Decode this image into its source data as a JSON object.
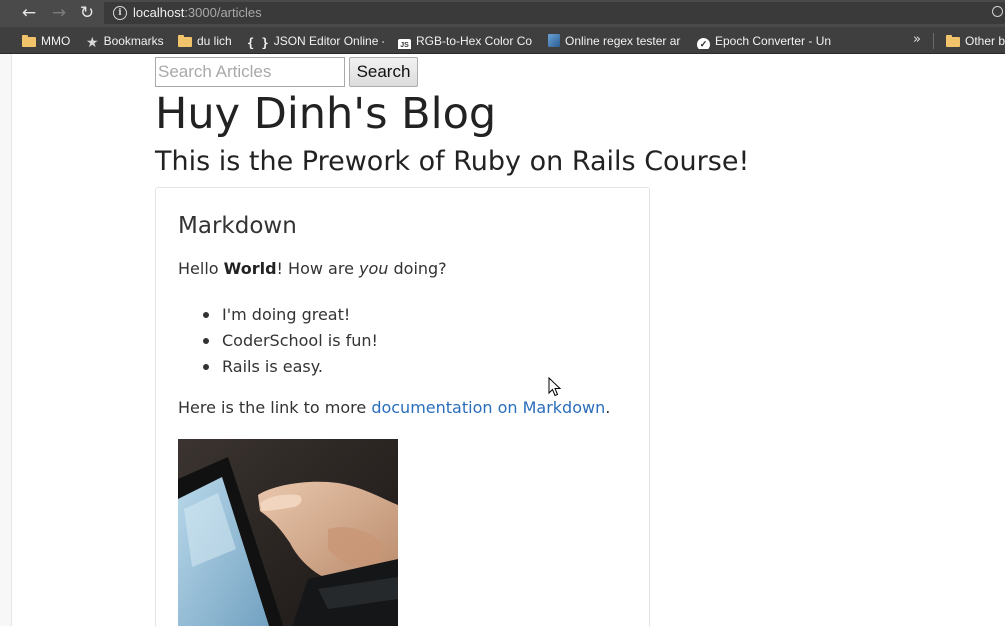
{
  "browser": {
    "url_host": "localhost",
    "url_path": ":3000/articles",
    "bookmarks": [
      {
        "label": "MMO",
        "icon": "folder-icon"
      },
      {
        "label": "Bookmarks",
        "icon": "star-icon"
      },
      {
        "label": "du lich",
        "icon": "folder-icon"
      },
      {
        "label": "JSON Editor Online - v",
        "icon": "braces-icon"
      },
      {
        "label": "RGB-to-Hex Color Co",
        "icon": "js-icon"
      },
      {
        "label": "Online regex tester ar",
        "icon": "regex-icon"
      },
      {
        "label": "Epoch Converter - Un",
        "icon": "clock-icon"
      },
      {
        "label": "Other b",
        "icon": "folder-icon"
      }
    ],
    "overflow_label": "»"
  },
  "search": {
    "placeholder": "Search Articles",
    "button_label": "Search"
  },
  "blog": {
    "title": "Huy Dinh's Blog",
    "subtitle": "This is the Prework of Ruby on Rails Course!"
  },
  "article": {
    "title": "Markdown",
    "greeting_prefix": "Hello ",
    "greeting_bold": "World",
    "greeting_middle": "! How are ",
    "greeting_italic": "you",
    "greeting_suffix": " doing?",
    "list_items": [
      "I'm doing great!",
      "CoderSchool is fun!",
      "Rails is easy."
    ],
    "link_prefix": "Here is the link to more ",
    "link_text": "documentation on Markdown",
    "link_suffix": "."
  },
  "colors": {
    "link": "#2a6ebb",
    "chrome_dark": "#4a4a4a",
    "text": "#333333"
  }
}
